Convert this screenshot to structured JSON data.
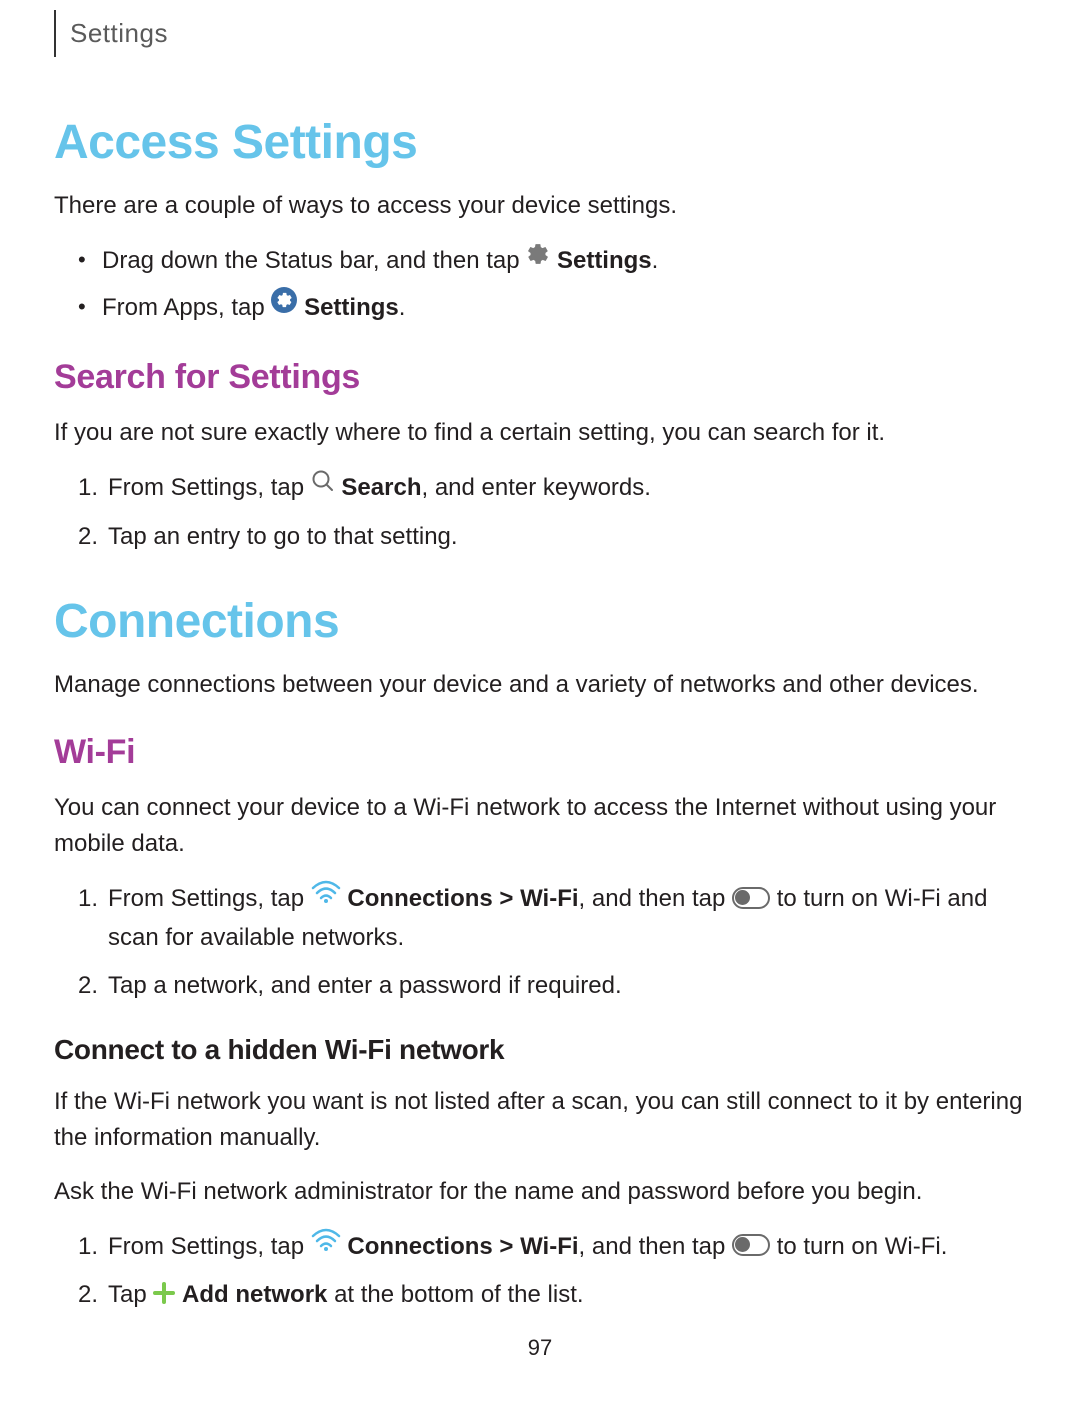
{
  "header": {
    "tab_label": "Settings"
  },
  "access_settings": {
    "title": "Access Settings",
    "intro": "There are a couple of ways to access your device settings.",
    "bullets": {
      "item1_pre": "Drag down the Status bar, and then tap ",
      "item1_bold": "Settings",
      "item1_post": ".",
      "item2_pre": "From Apps, tap ",
      "item2_bold": "Settings",
      "item2_post": "."
    }
  },
  "search_settings": {
    "title": "Search for Settings",
    "intro": "If you are not sure exactly where to find a certain setting, you can search for it.",
    "steps": {
      "s1_pre": "From Settings, tap ",
      "s1_bold": "Search",
      "s1_post": ", and enter keywords.",
      "s2": "Tap an entry to go to that setting."
    }
  },
  "connections": {
    "title": "Connections",
    "intro": "Manage connections between your device and a variety of networks and other devices."
  },
  "wifi": {
    "title": "Wi-Fi",
    "intro": "You can connect your device to a Wi-Fi network to access the Internet without using your mobile data.",
    "steps": {
      "s1_pre": "From Settings, tap ",
      "s1_bold": "Connections > Wi-Fi",
      "s1_mid": ", and then tap ",
      "s1_post": " to turn on Wi-Fi and scan for available networks.",
      "s2": "Tap a network, and enter a password if required."
    }
  },
  "hidden_wifi": {
    "title": "Connect to a hidden Wi-Fi network",
    "intro": "If the Wi-Fi network you want is not listed after a scan, you can still connect to it by entering the information manually.",
    "note": "Ask the Wi-Fi network administrator for the name and password before you begin.",
    "steps": {
      "s1_pre": "From Settings, tap ",
      "s1_bold": "Connections > Wi-Fi",
      "s1_mid": ", and then tap ",
      "s1_post": " to turn on Wi-Fi.",
      "s2_pre": "Tap ",
      "s2_bold": "Add network",
      "s2_post": " at the bottom of the list."
    }
  },
  "page_number": "97"
}
